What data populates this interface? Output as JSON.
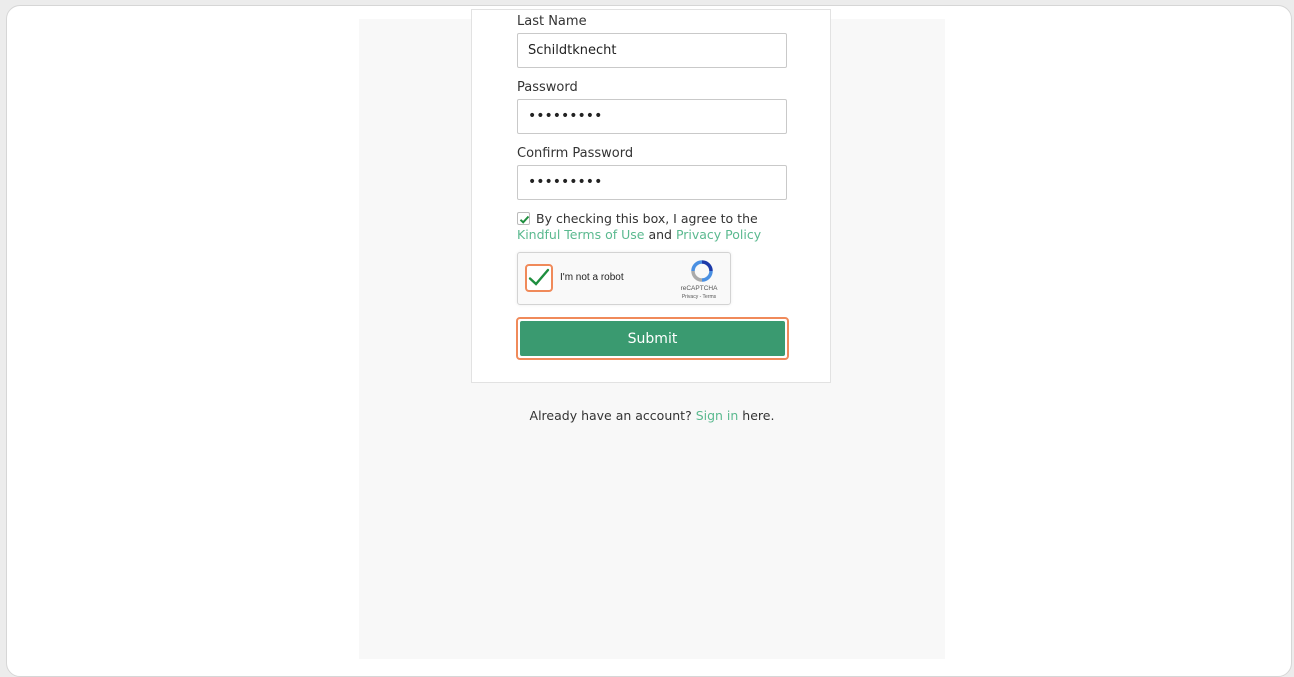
{
  "form": {
    "last_name_label": "Last Name",
    "last_name_value": "Schildtknecht",
    "password_label": "Password",
    "password_value": "•••••••••",
    "confirm_label": "Confirm Password",
    "confirm_value": "•••••••••",
    "agree_text": "By checking this box, I agree to the ",
    "terms_link": "Kindful Terms of Use",
    "and_text": " and ",
    "privacy_link": "Privacy Policy",
    "agree_checked": true,
    "submit_label": "Submit"
  },
  "captcha": {
    "label": "I'm not a robot",
    "brand": "reCAPTCHA",
    "links": "Privacy - Terms",
    "checked": true
  },
  "footer": {
    "prefix": "Already have an account? ",
    "signin_link": "Sign in",
    "suffix": " here."
  },
  "colors": {
    "accent_green": "#3a9a70",
    "link_green": "#5ab98f",
    "highlight_orange": "#f08a5a",
    "checkmark_green": "#1e8e3e"
  }
}
